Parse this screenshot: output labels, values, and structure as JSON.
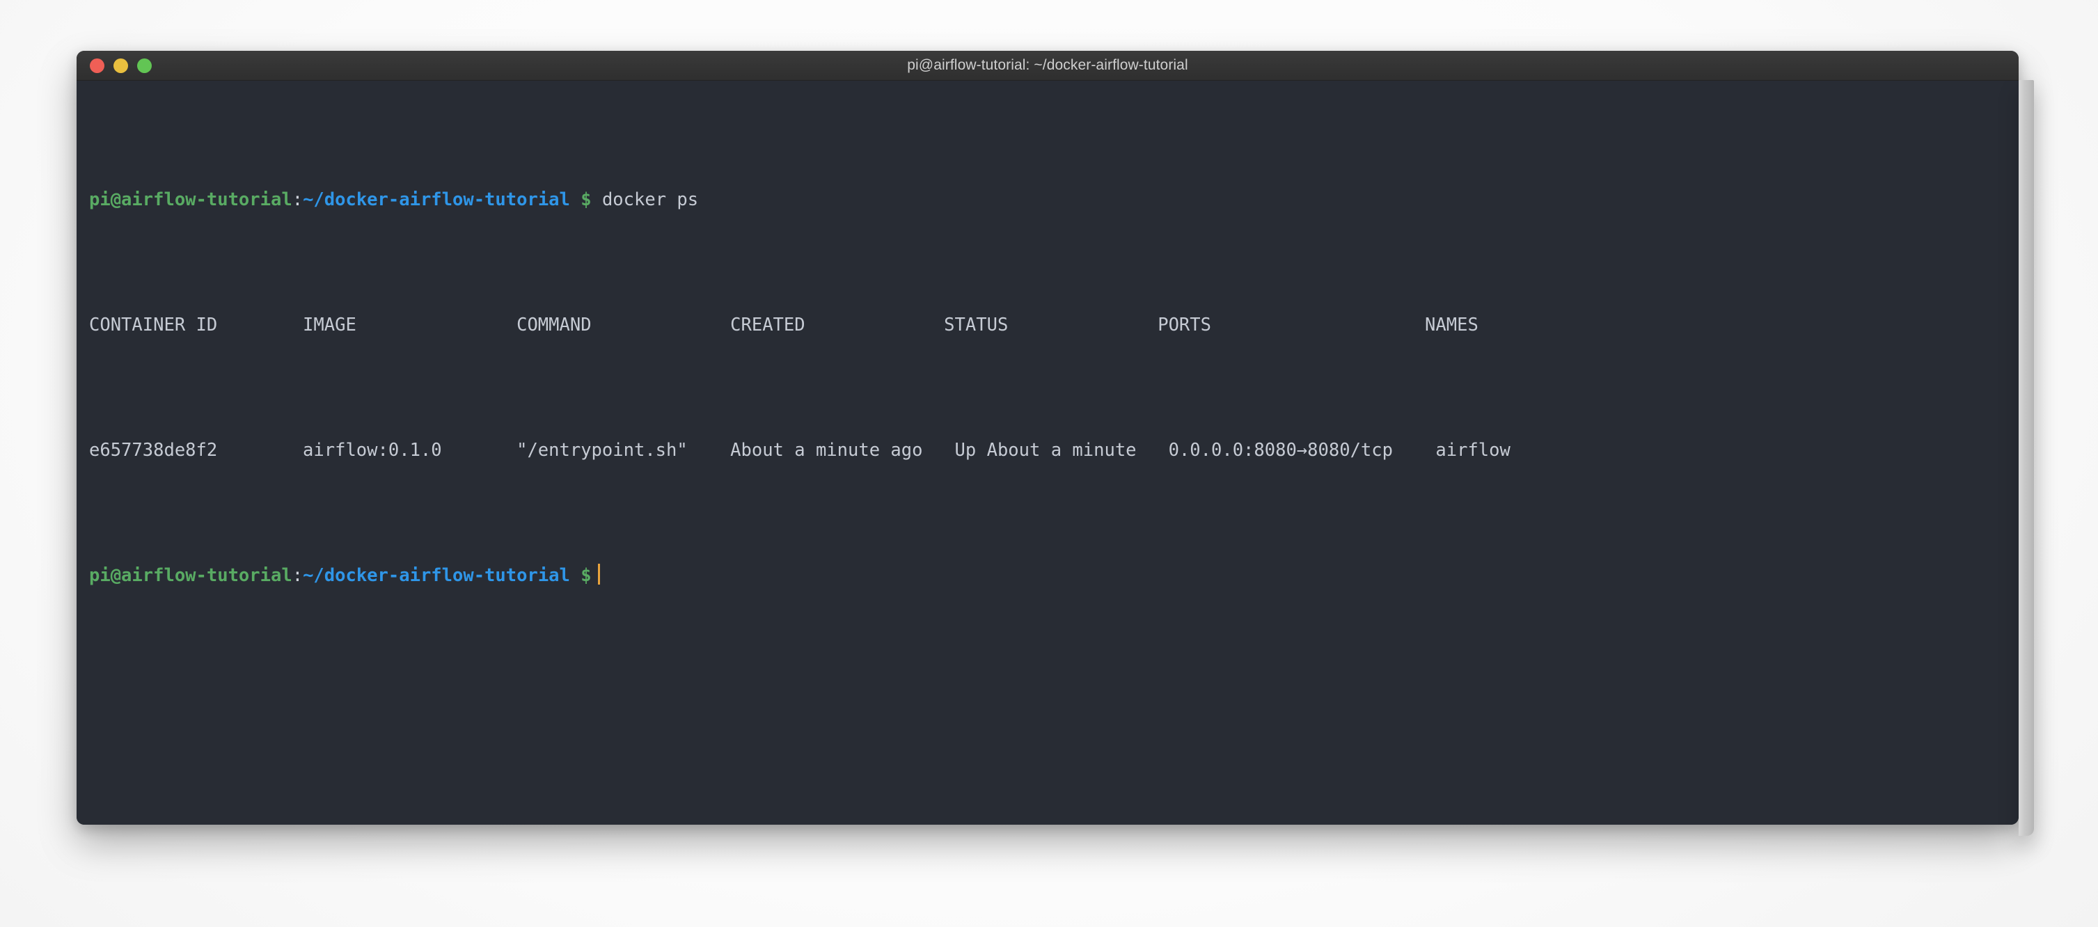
{
  "window": {
    "title": "pi@airflow-tutorial: ~/docker-airflow-tutorial",
    "controls": {
      "close_label": "",
      "minimize_label": "",
      "zoom_label": ""
    }
  },
  "colors": {
    "background": "#282c34",
    "titlebar": "#343434",
    "foreground": "#c6cbd4",
    "prompt_user": "#59ab63",
    "prompt_path": "#2f96e8",
    "cursor": "#e8a33d",
    "close_dot": "#ef5f56",
    "minimize_dot": "#e9bf3f",
    "zoom_dot": "#62c554"
  },
  "prompt": {
    "user_host": "pi@airflow-tutorial",
    "colon": ":",
    "path": "~/docker-airflow-tutorial",
    "sigil": "$"
  },
  "command_line": {
    "command": "docker ps"
  },
  "output": {
    "headers_line": "CONTAINER ID        IMAGE               COMMAND             CREATED             STATUS              PORTS                    NAMES",
    "row_line": "e657738de8f2        airflow:0.1.0       \"/entrypoint.sh\"    About a minute ago   Up About a minute   0.0.0.0:8080→8080/tcp    airflow",
    "columns": [
      "CONTAINER ID",
      "IMAGE",
      "COMMAND",
      "CREATED",
      "STATUS",
      "PORTS",
      "NAMES"
    ],
    "rows": [
      {
        "container_id": "e657738de8f2",
        "image": "airflow:0.1.0",
        "command": "\"/entrypoint.sh\"",
        "created": "About a minute ago",
        "status": "Up About a minute",
        "ports": "0.0.0.0:8080→8080/tcp",
        "names": "airflow"
      }
    ]
  }
}
